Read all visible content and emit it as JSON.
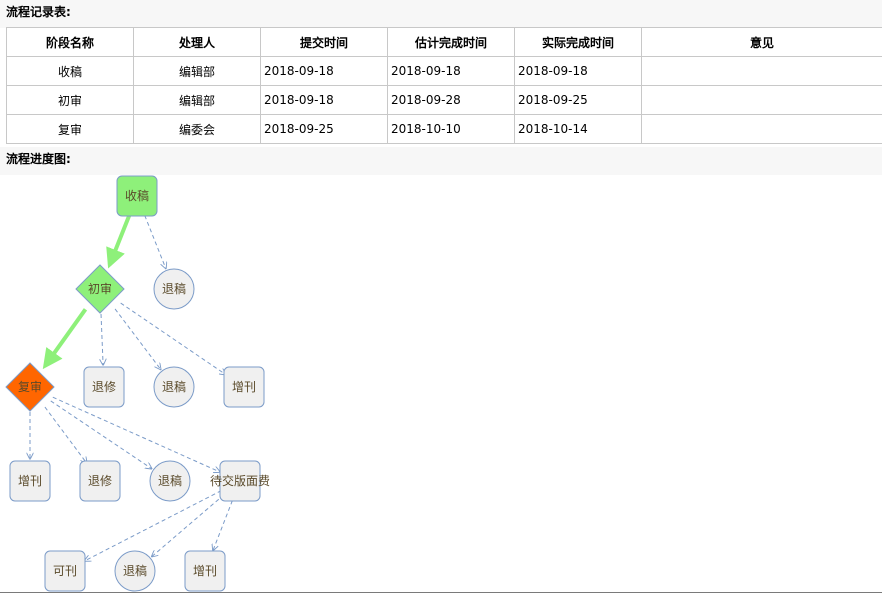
{
  "records": {
    "title": "流程记录表:",
    "columns": [
      "阶段名称",
      "处理人",
      "提交时间",
      "估计完成时间",
      "实际完成时间",
      "意见"
    ],
    "rows": [
      [
        "收稿",
        "编辑部",
        "2018-09-18",
        "2018-09-18",
        "2018-09-18",
        ""
      ],
      [
        "初审",
        "编辑部",
        "2018-09-18",
        "2018-09-28",
        "2018-09-25",
        ""
      ],
      [
        "复审",
        "编委会",
        "2018-09-25",
        "2018-10-10",
        "2018-10-14",
        ""
      ]
    ]
  },
  "flow": {
    "title": "流程进度图:",
    "nodes": {
      "shougao": {
        "label": "收稿",
        "shape": "rounded-rect",
        "status": "done"
      },
      "chushen": {
        "label": "初审",
        "shape": "diamond",
        "status": "done"
      },
      "fushen": {
        "label": "复审",
        "shape": "diamond",
        "status": "current"
      },
      "tuigao1": {
        "label": "退稿",
        "shape": "circle"
      },
      "tuixiu1": {
        "label": "退修",
        "shape": "rounded-rect"
      },
      "tuigao2": {
        "label": "退稿",
        "shape": "circle"
      },
      "zengkan1": {
        "label": "增刊",
        "shape": "rounded-rect"
      },
      "zengkan2": {
        "label": "增刊",
        "shape": "rounded-rect"
      },
      "tuixiu2": {
        "label": "退修",
        "shape": "rounded-rect"
      },
      "tuigao3": {
        "label": "退稿",
        "shape": "circle"
      },
      "daijiao": {
        "label": "待交版面费",
        "shape": "rounded-rect"
      },
      "kekan": {
        "label": "可刊",
        "shape": "rounded-rect"
      },
      "tuigao4": {
        "label": "退稿",
        "shape": "circle"
      },
      "zengkan3": {
        "label": "增刊",
        "shape": "rounded-rect"
      }
    },
    "colors": {
      "done": "#8ef07a",
      "current": "#ff6600",
      "pending": "#f0f0f0",
      "node_border": "#7b9bc8",
      "active_edge": "#8ef07a",
      "option_edge": "#7b9bc8"
    }
  }
}
